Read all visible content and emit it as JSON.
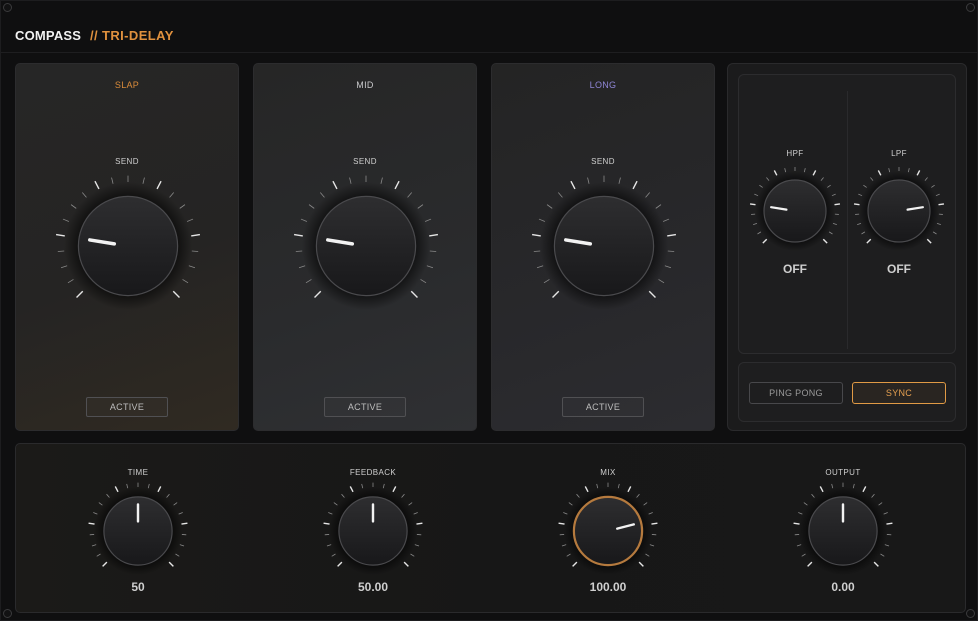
{
  "header": {
    "brand": "COMPASS",
    "product": "// TRI-DELAY"
  },
  "colors": {
    "accent": "#e0913e",
    "slap": "#d98b3a",
    "mid": "#c9c9cc",
    "long": "#8f86d6"
  },
  "delays": [
    {
      "title": "SLAP",
      "knob_label": "SEND",
      "knob_value": 0.2,
      "active_label": "ACTIVE"
    },
    {
      "title": "MID",
      "knob_label": "SEND",
      "knob_value": 0.2,
      "active_label": "ACTIVE"
    },
    {
      "title": "LONG",
      "knob_label": "SEND",
      "knob_value": 0.2,
      "active_label": "ACTIVE"
    }
  ],
  "filters": [
    {
      "label": "HPF",
      "value": "OFF",
      "knob_value": 0.2
    },
    {
      "label": "LPF",
      "value": "OFF",
      "knob_value": 0.8
    }
  ],
  "buttons": {
    "ping_pong": "PING PONG",
    "sync": "SYNC"
  },
  "bottom": [
    {
      "label": "TIME",
      "value": "50",
      "knob_value": 0.5
    },
    {
      "label": "FEEDBACK",
      "value": "50.00",
      "knob_value": 0.5
    },
    {
      "label": "MIX",
      "value": "100.00",
      "knob_value": 0.78,
      "highlight": true
    },
    {
      "label": "OUTPUT",
      "value": "0.00",
      "knob_value": 0.5
    }
  ]
}
